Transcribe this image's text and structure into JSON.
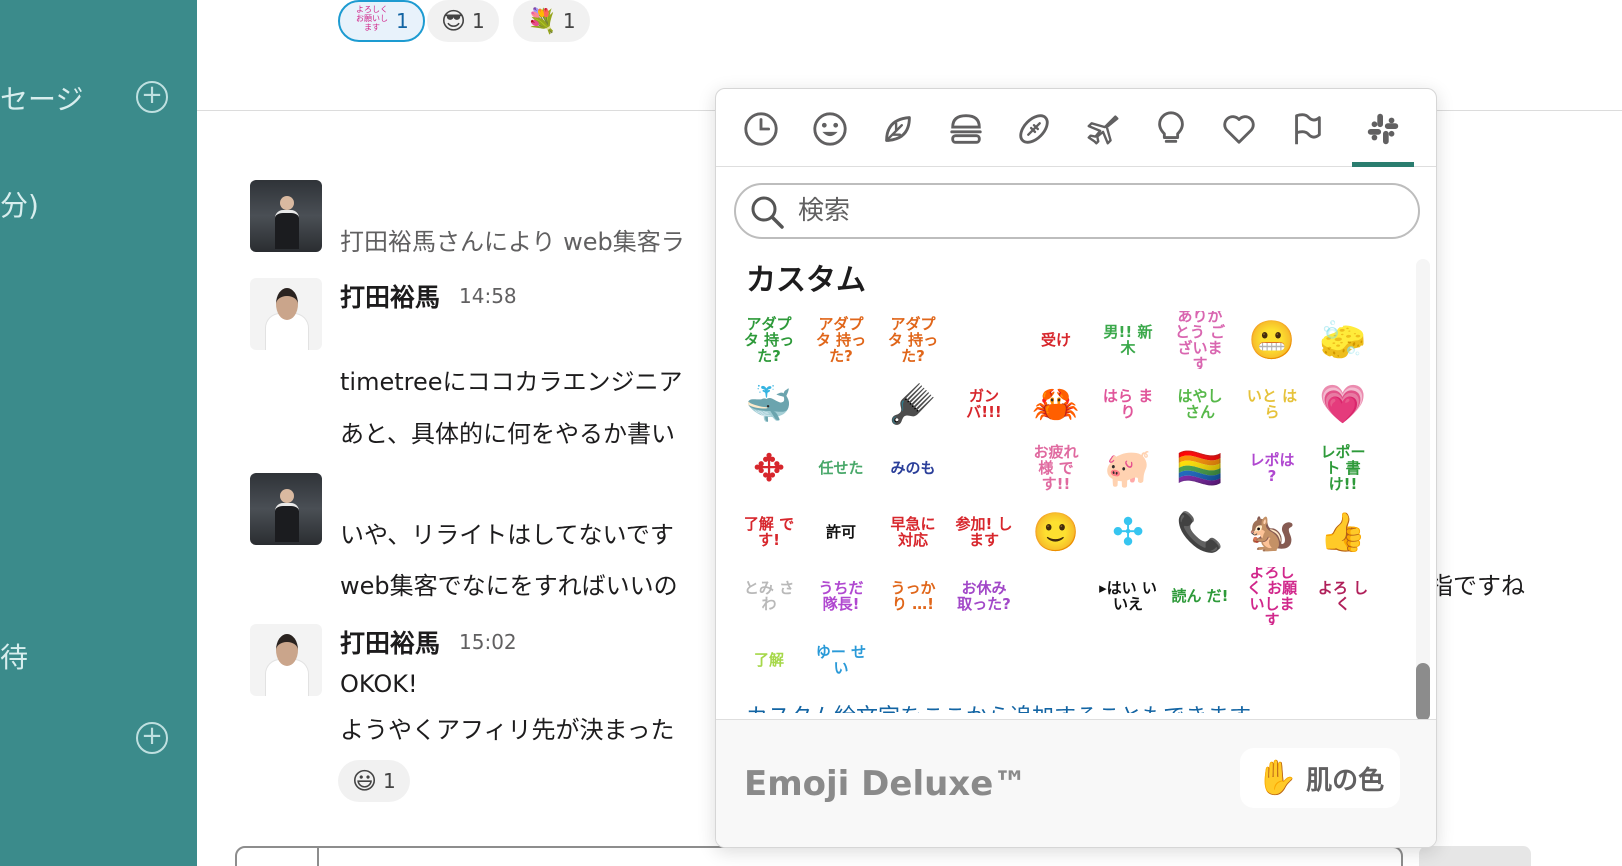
{
  "sidebar": {
    "items": [
      {
        "label": "セージ"
      },
      {
        "label": "分)"
      },
      {
        "label": "待"
      }
    ]
  },
  "reactions_top": [
    {
      "emoji": "よろしく お願いします",
      "count": "1"
    },
    {
      "emoji": "😎",
      "count": "1"
    },
    {
      "emoji": "💐",
      "count": "1"
    }
  ],
  "messages": {
    "system_text": "打田裕馬さんにより web集客ラ",
    "author1": "打田裕馬",
    "time1": "14:58",
    "m1_line1": "timetreeにココカラエンジニア",
    "m1_line2": "あと、具体的に何をやるか書い",
    "m2_line1": "いや、リライトはしてないです",
    "m2_line2": "web集客でなにをすればいいの",
    "m2_line2_tail": "指ですね",
    "author2": "打田裕馬",
    "time2": "15:02",
    "m3_line1": "OKOK!",
    "m3_line2": "ようやくアフィリ先が決まった",
    "reaction_bottom": {
      "emoji": "😃",
      "count": "1"
    }
  },
  "picker": {
    "tabs": [
      "clock-icon",
      "smiley-icon",
      "leaf-icon",
      "burger-icon",
      "football-icon",
      "plane-icon",
      "bulb-icon",
      "heart-icon",
      "flag-icon",
      "slack-icon"
    ],
    "search_placeholder": "検索",
    "section_title": "カスタム",
    "emojis": [
      {
        "text": "アダプタ 持った?",
        "color": "#2e9a3a"
      },
      {
        "text": "アダプタ 持った?",
        "color": "#e0661a"
      },
      {
        "text": "アダプタ 持った?",
        "color": "#e0661a"
      },
      {
        "text": "",
        "color": "#c44"
      },
      {
        "text": "受け",
        "color": "#d7262c"
      },
      {
        "text": "男!! 新木",
        "color": "#3aa84a"
      },
      {
        "text": "ありがとう ございます",
        "color": "#d966b0"
      },
      {
        "text": "😬",
        "color": "#000000"
      },
      {
        "text": "🧽",
        "color": "#000000"
      },
      {
        "text": "🐳",
        "color": "#000000"
      },
      {
        "text": "",
        "color": "#000000"
      },
      {
        "text": "🪮",
        "color": "#000000"
      },
      {
        "text": "ガン バ!!!",
        "color": "#d7262c"
      },
      {
        "text": "🦀",
        "color": "#000000"
      },
      {
        "text": "はら まり",
        "color": "#e0559a"
      },
      {
        "text": "はやし さん",
        "color": "#57b84a"
      },
      {
        "text": "いと はら",
        "color": "#e6c23a"
      },
      {
        "text": "💗",
        "color": "#000000"
      },
      {
        "text": "✥",
        "color": "#d7262c"
      },
      {
        "text": "任せた",
        "color": "#49a86a"
      },
      {
        "text": "みのも",
        "color": "#2b3f9a"
      },
      {
        "text": "",
        "color": "#999999"
      },
      {
        "text": "お疲れ様 です!!",
        "color": "#e06aa0"
      },
      {
        "text": "🐖",
        "color": "#000000"
      },
      {
        "text": "🏳️‍🌈",
        "color": "#000000"
      },
      {
        "text": "レポは ?",
        "color": "#b048d0"
      },
      {
        "text": "レポート 書け!!",
        "color": "#2e9a3a"
      },
      {
        "text": "了解 です!",
        "color": "#d7262c"
      },
      {
        "text": "許可",
        "color": "#111111"
      },
      {
        "text": "早急に 対応",
        "color": "#d7262c"
      },
      {
        "text": "参加! します",
        "color": "#d7262c"
      },
      {
        "text": "🙂",
        "color": "#000000"
      },
      {
        "text": "✣",
        "color": "#36c5f0"
      },
      {
        "text": "📞",
        "color": "#000000"
      },
      {
        "text": "🐿️",
        "color": "#000000"
      },
      {
        "text": "👍",
        "color": "#000000"
      },
      {
        "text": "とみ さわ",
        "color": "#b9b9b9"
      },
      {
        "text": "うちだ 隊長!",
        "color": "#b048d0"
      },
      {
        "text": "うっかり …!",
        "color": "#e0661a"
      },
      {
        "text": "お休み 取った?",
        "color": "#a248c8"
      },
      {
        "text": "",
        "color": "#000000"
      },
      {
        "text": "▸はい いいえ",
        "color": "#111111"
      },
      {
        "text": "読ん だ!",
        "color": "#2e9a3a"
      },
      {
        "text": "よろしく お願いします",
        "color": "#d1278b"
      },
      {
        "text": "よろ しく",
        "color": "#b0205a"
      },
      {
        "text": "了解",
        "color": "#a6d84a"
      },
      {
        "text": "ゆー せい",
        "color": "#2a9ad8"
      },
      {
        "text": "",
        "color": "#d7262c"
      }
    ],
    "hint_text": "カスタム絵文字をここから追加することもできます",
    "brand": "Emoji Deluxe™",
    "skin_tone_emoji": "✋",
    "skin_tone_label": "肌の色"
  }
}
